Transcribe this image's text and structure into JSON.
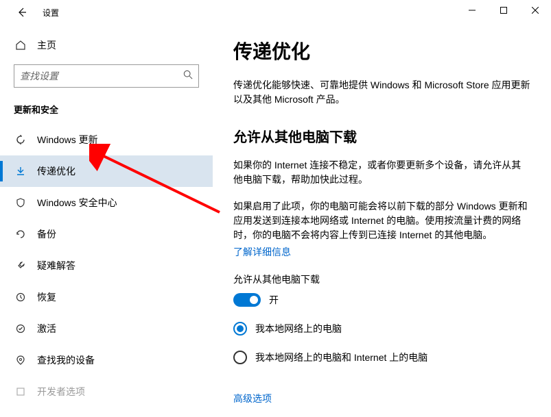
{
  "window": {
    "title": "设置"
  },
  "sidebar": {
    "home_label": "主页",
    "search_placeholder": "查找设置",
    "category": "更新和安全",
    "items": [
      {
        "label": "Windows 更新",
        "icon": "sync"
      },
      {
        "label": "传递优化",
        "icon": "delivery",
        "active": true
      },
      {
        "label": "Windows 安全中心",
        "icon": "shield"
      },
      {
        "label": "备份",
        "icon": "backup"
      },
      {
        "label": "疑难解答",
        "icon": "troubleshoot"
      },
      {
        "label": "恢复",
        "icon": "recovery"
      },
      {
        "label": "激活",
        "icon": "activation"
      },
      {
        "label": "查找我的设备",
        "icon": "find-device"
      },
      {
        "label": "开发者选项",
        "icon": "developer"
      }
    ]
  },
  "content": {
    "title": "传递优化",
    "intro": "传递优化能够快速、可靠地提供 Windows 和 Microsoft Store 应用更新以及其他 Microsoft 产品。",
    "section_title": "允许从其他电脑下载",
    "para1": "如果你的 Internet 连接不稳定，或者你要更新多个设备，请允许从其他电脑下载，帮助加快此过程。",
    "para2": "如果启用了此项，你的电脑可能会将以前下载的部分 Windows 更新和应用发送到连接本地网络或 Internet 的电脑。使用按流量计费的网络时，你的电脑不会将内容上传到已连接 Internet 的其他电脑。",
    "learn_more": "了解详细信息",
    "toggle_caption": "允许从其他电脑下载",
    "toggle_state": "开",
    "radio1": "我本地网络上的电脑",
    "radio2": "我本地网络上的电脑和 Internet 上的电脑",
    "advanced": "高级选项"
  }
}
